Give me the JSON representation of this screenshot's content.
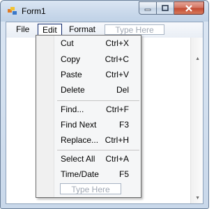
{
  "window": {
    "title": "Form1"
  },
  "menubar": {
    "file": "File",
    "edit": "Edit",
    "format": "Format",
    "type_here": "Type Here"
  },
  "edit_menu": {
    "items": [
      {
        "label": "Cut",
        "shortcut": "Ctrl+X"
      },
      {
        "label": "Copy",
        "shortcut": "Ctrl+C"
      },
      {
        "label": "Paste",
        "shortcut": "Ctrl+V"
      },
      {
        "label": "Delete",
        "shortcut": "Del"
      },
      {
        "label": "Find...",
        "shortcut": "Ctrl+F"
      },
      {
        "label": "Find Next",
        "shortcut": "F3"
      },
      {
        "label": "Replace...",
        "shortcut": "Ctrl+H"
      },
      {
        "label": "Select All",
        "shortcut": "Ctrl+A"
      },
      {
        "label": "Time/Date",
        "shortcut": "F5"
      }
    ],
    "type_here": "Type Here"
  },
  "colors": {
    "close_button": "#c24a32",
    "menu_border": "#0a246a"
  },
  "icons": {
    "app": "app-icon",
    "minimize": "minimize-icon",
    "maximize": "maximize-icon",
    "close": "close-icon"
  }
}
